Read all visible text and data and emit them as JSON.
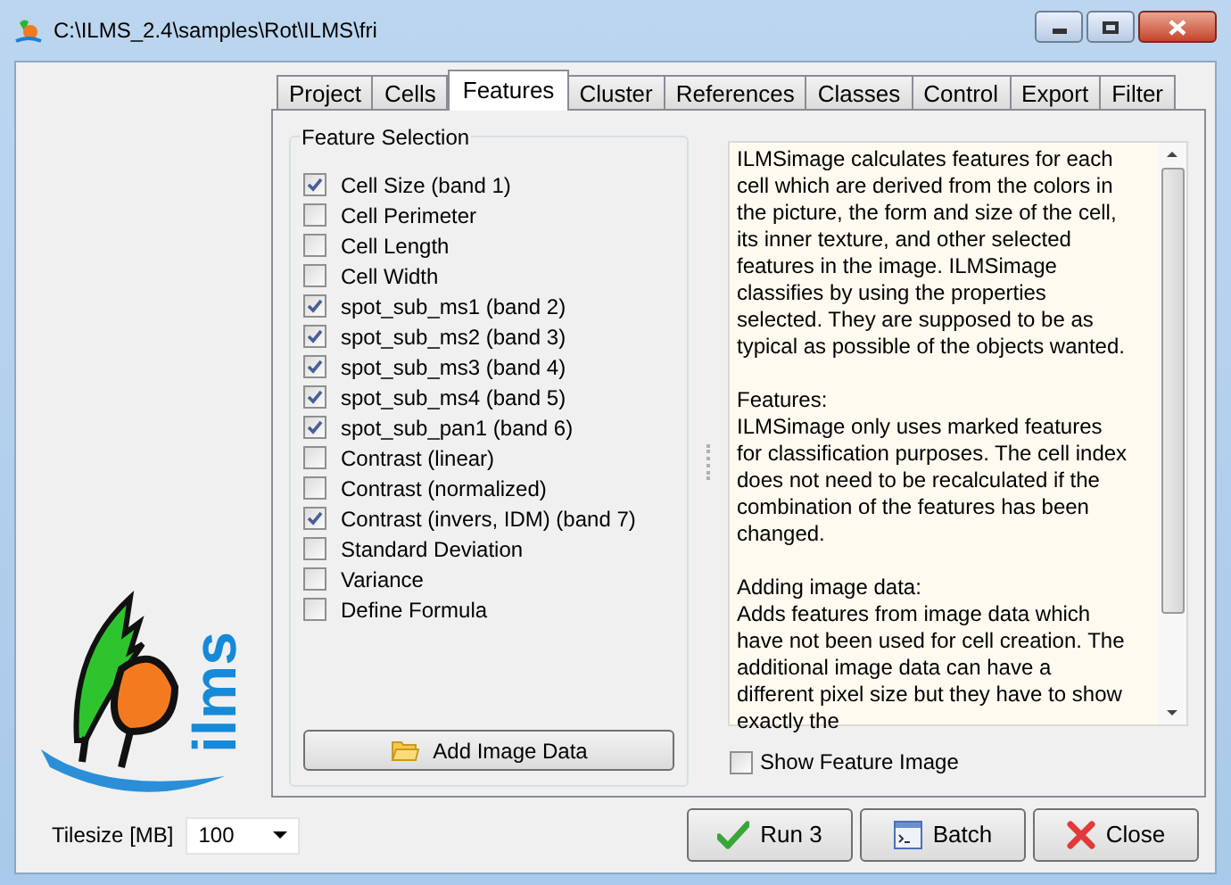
{
  "window": {
    "title": "C:\\ILMS_2.4\\samples\\Rot\\ILMS\\fri"
  },
  "logo": {
    "text": "ilms"
  },
  "tabs": [
    {
      "label": "Project",
      "selected": false
    },
    {
      "label": "Cells",
      "selected": false
    },
    {
      "label": "Features",
      "selected": true
    },
    {
      "label": "Cluster",
      "selected": false
    },
    {
      "label": "References",
      "selected": false
    },
    {
      "label": "Classes",
      "selected": false
    },
    {
      "label": "Control",
      "selected": false
    },
    {
      "label": "Export",
      "selected": false
    },
    {
      "label": "Filter",
      "selected": false
    }
  ],
  "feature_selection": {
    "title": "Feature Selection",
    "items": [
      {
        "label": "Cell Size (band 1)",
        "checked": true
      },
      {
        "label": "Cell Perimeter",
        "checked": false
      },
      {
        "label": "Cell Length",
        "checked": false
      },
      {
        "label": "Cell Width",
        "checked": false
      },
      {
        "label": "spot_sub_ms1 (band 2)",
        "checked": true
      },
      {
        "label": "spot_sub_ms2 (band 3)",
        "checked": true
      },
      {
        "label": "spot_sub_ms3 (band 4)",
        "checked": true
      },
      {
        "label": "spot_sub_ms4 (band 5)",
        "checked": true
      },
      {
        "label": "spot_sub_pan1 (band 6)",
        "checked": true
      },
      {
        "label": "Contrast (linear)",
        "checked": false
      },
      {
        "label": "Contrast (normalized)",
        "checked": false
      },
      {
        "label": "Contrast (invers, IDM) (band 7)",
        "checked": true
      },
      {
        "label": "Standard Deviation",
        "checked": false
      },
      {
        "label": "Variance",
        "checked": false
      },
      {
        "label": "Define Formula",
        "checked": false
      }
    ],
    "button": "Add Image Data"
  },
  "help_text": [
    "ILMSimage calculates features for each cell which are derived from the colors in the picture, the form and size of the cell, its inner texture, and other selected features in the image. ILMSimage classifies by using the properties selected. They are supposed to be as typical as possible of the objects wanted.",
    "Features:\nILMSimage only uses marked features for classification purposes. The cell index does not need to be recalculated if the combination of the features has been changed.",
    "Adding image data:\nAdds features from image data which have not been used for cell creation. The additional image data can have a different pixel size but they have to show exactly the"
  ],
  "show_feature_image": {
    "label": "Show Feature Image",
    "checked": false
  },
  "tilesize": {
    "label": "Tilesize [MB]",
    "value": "100"
  },
  "buttons": [
    {
      "kind": "run",
      "label": "Run 3"
    },
    {
      "kind": "batch",
      "label": "Batch"
    },
    {
      "kind": "close",
      "label": "Close"
    }
  ]
}
